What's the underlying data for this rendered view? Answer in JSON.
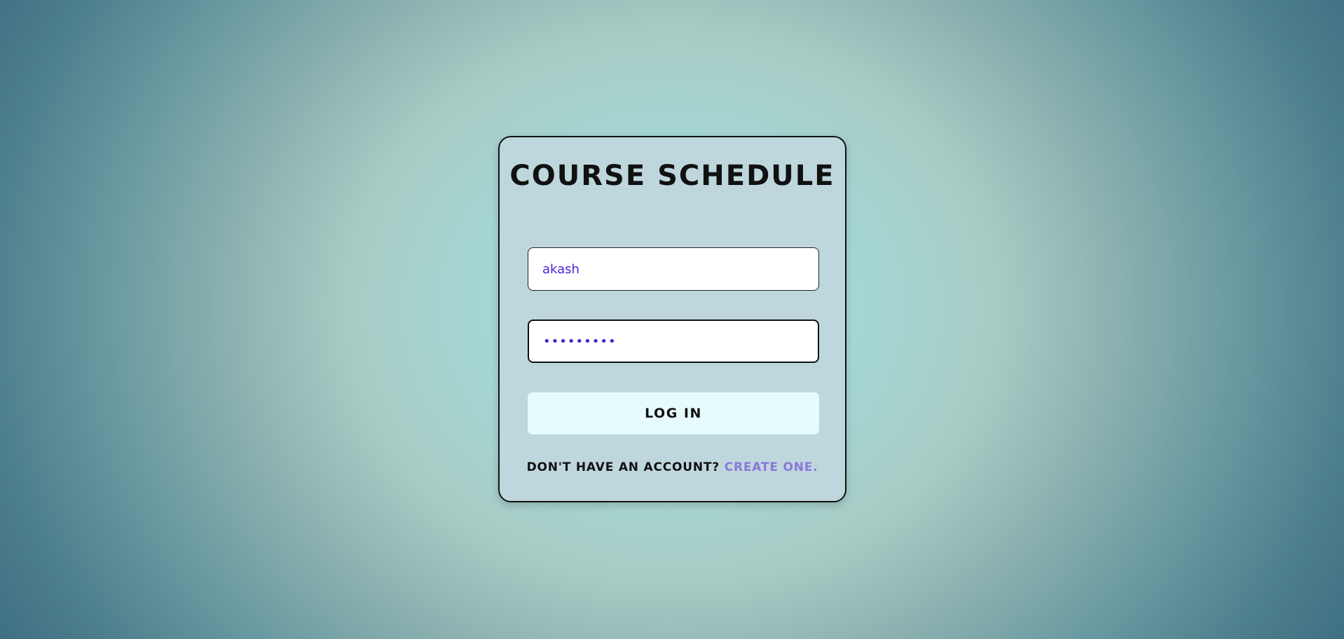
{
  "login_card": {
    "title": "COURSE SCHEDULE",
    "username": {
      "value": "akash"
    },
    "password": {
      "value": "•••••••••"
    },
    "login_button": "LOG IN",
    "signup_prompt": "DON'T HAVE AN ACCOUNT?",
    "signup_link": "CREATE ONE."
  },
  "colors": {
    "card_background": "#bed7dd",
    "input_text": "#4a1fd6",
    "button_background": "#e6fbfd",
    "link": "#8a78d8",
    "background_center": "#a6dcdb",
    "background_edge": "#3a6a80"
  }
}
